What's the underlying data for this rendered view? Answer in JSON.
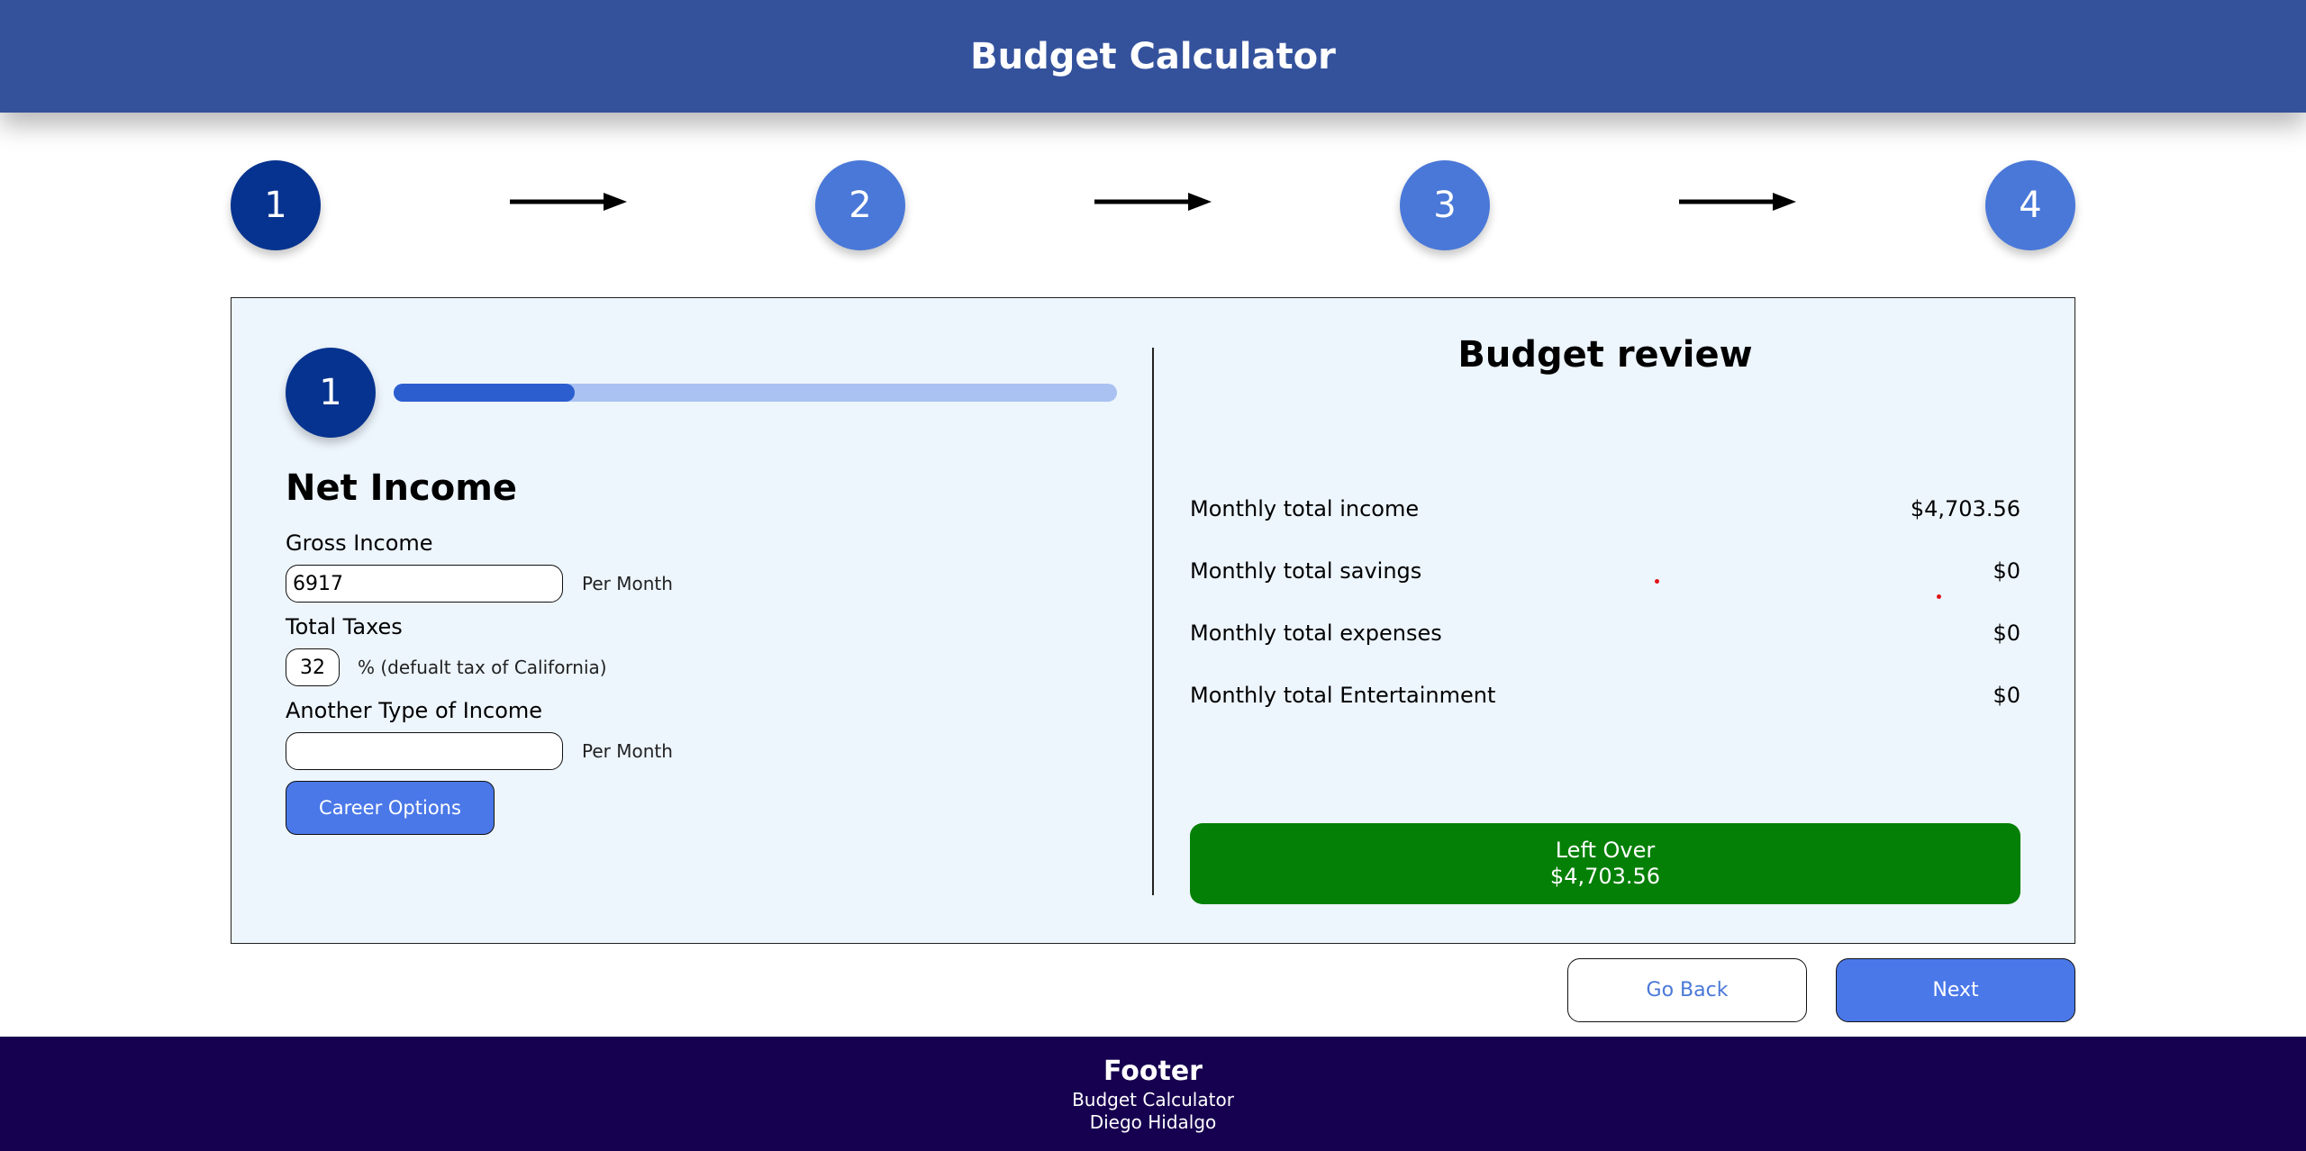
{
  "header": {
    "title": "Budget Calculator"
  },
  "stepper": {
    "steps": [
      "1",
      "2",
      "3",
      "4"
    ],
    "active": 0
  },
  "income_panel": {
    "badge": "1",
    "progress_fraction": 0.25,
    "title": "Net Income",
    "gross_income_label": "Gross Income",
    "gross_income_value": "6917",
    "gross_income_suffix": "Per Month",
    "taxes_label": "Total Taxes",
    "taxes_value": "32",
    "taxes_suffix": "% (defualt tax of California)",
    "other_income_label": "Another Type of Income",
    "other_income_value": "",
    "other_income_suffix": "Per Month",
    "career_button_label": "Career Options"
  },
  "review": {
    "title": "Budget review",
    "rows": [
      {
        "label": "Monthly total income",
        "value": "$4,703.56"
      },
      {
        "label": "Monthly total savings",
        "value": "$0"
      },
      {
        "label": "Monthly total expenses",
        "value": "$0"
      },
      {
        "label": "Monthly total Entertainment",
        "value": "$0"
      }
    ],
    "leftover_label": "Left Over",
    "leftover_value": "$4,703.56",
    "leftover_color": "#058006"
  },
  "nav": {
    "back_label": "Go Back",
    "next_label": "Next"
  },
  "footer": {
    "title": "Footer",
    "line1": "Budget Calculator",
    "line2": "Diego Hidalgo"
  },
  "colors": {
    "header": "#34529c",
    "active_step": "#06338f",
    "step": "#4a78d8",
    "button": "#4a78e8",
    "footer": "#160050",
    "panel": "#edf5fd"
  }
}
